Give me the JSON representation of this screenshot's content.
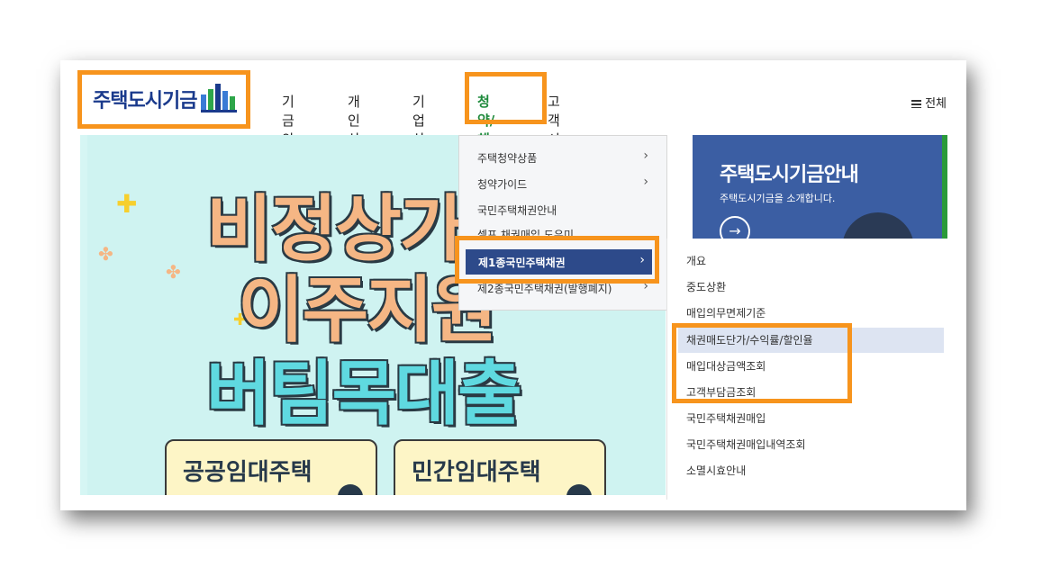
{
  "header": {
    "logo_text": "주택도시기금",
    "nav": [
      "기금안내",
      "개인상품",
      "기업상품",
      "청약/채권",
      "고객서비스"
    ],
    "menu_all": "전체"
  },
  "banner": {
    "headline_1": "비정상가",
    "headline_2": "이주지원",
    "headline_3": "버팀목대출",
    "card_1": "공공임대주택",
    "card_2": "민간임대주택"
  },
  "dropdown_1": {
    "items": [
      "주택청약상품",
      "청약가이드",
      "국민주택채권안내",
      "셀프 채권매입 도우미",
      "제1종국민주택채권",
      "제2종국민주택채권(발행폐지)"
    ],
    "selected": "제1종국민주택채권"
  },
  "info_panel": {
    "title": "주택도시기금안내",
    "subtitle": "주택도시기금을 소개합니다."
  },
  "dropdown_2": {
    "items": [
      "개요",
      "중도상환",
      "매입의무면제기준",
      "채권매도단가/수익률/할인율",
      "매입대상금액조회",
      "고객부담금조회",
      "국민주택채권매입",
      "국민주택채권매입내역조회",
      "소멸시효안내"
    ],
    "highlighted": "채권매도단가/수익률/할인율"
  },
  "colors": {
    "highlight_box": "#f7941d",
    "brand_blue": "#1a3a8c",
    "active_green": "#1e8a3c",
    "menu_selected": "#2d4a8a"
  }
}
